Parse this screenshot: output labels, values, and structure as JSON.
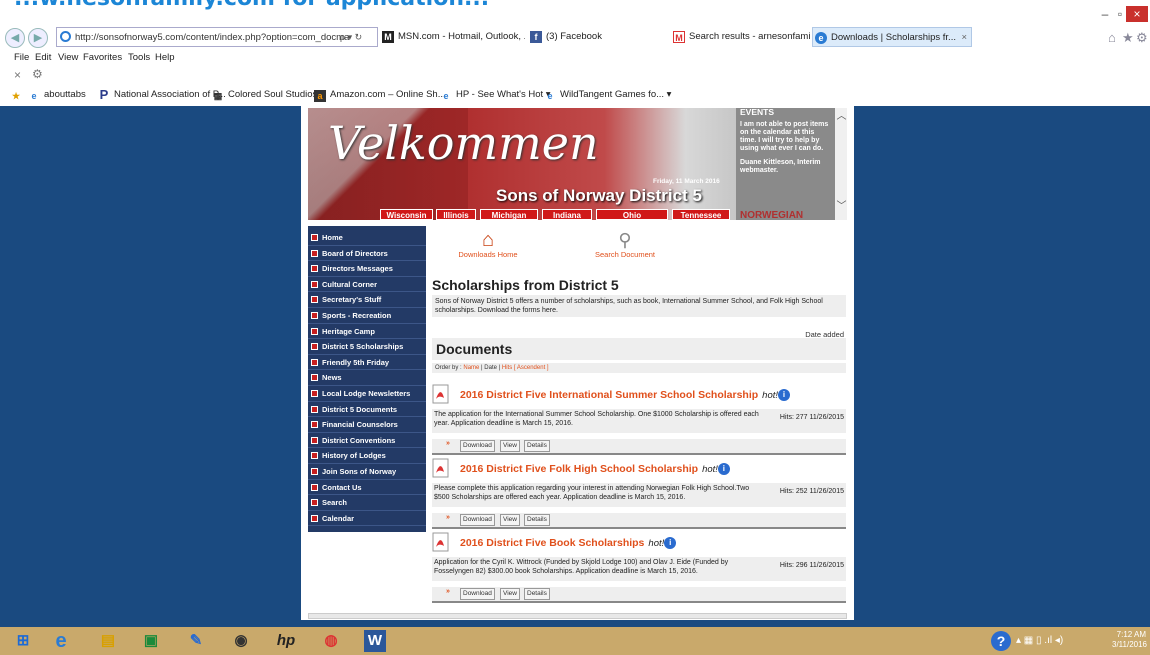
{
  "top_banner": {
    "text": "...w.nesonfamily.com for application..."
  },
  "browser": {
    "address": "http://sonsofnorway5.com/content/index.php?option=com_docma",
    "address_icons": "ρ ▾ ↻",
    "tabs": [
      {
        "label": "MSN.com - Hotmail, Outlook, ...",
        "icon": "msn-icon"
      },
      {
        "label": "(3) Facebook",
        "icon": "facebook-icon"
      },
      {
        "label": "Search results - arnesonfamily...",
        "icon": "gmail-icon"
      },
      {
        "label": "Downloads | Scholarships fr...",
        "icon": "ie-icon"
      }
    ],
    "tab_close": "×",
    "menu": [
      "File",
      "Edit",
      "View",
      "Favorites",
      "Tools",
      "Help"
    ],
    "command_close": "×",
    "favorites": [
      "abouttabs",
      "National Association of P...",
      "Colored Soul Studios",
      "Amazon.com – Online Sh...",
      "HP - See What's Hot ▾",
      "WildTangent Games fo... ▾"
    ],
    "window_controls": {
      "minimize": "–",
      "maximize": "▫",
      "close": "×"
    }
  },
  "site": {
    "welcome": "Velkommen",
    "date": "Friday, 11 March 2016",
    "title": "Sons of Norway District 5",
    "states": [
      "Wisconsin",
      "Illinois",
      "Michigan",
      "Indiana",
      "Ohio",
      "Tennessee"
    ],
    "events": {
      "heading": "EVENTS",
      "text1": "I am not able to post items on the calendar at this time.  I will try to help by using what ever I can do.",
      "text2": "Duane Kittleson, Interim webmaster.",
      "more": "NORWEGIAN"
    },
    "menu": [
      "Home",
      "Board of Directors",
      "Directors Messages",
      "Cultural Corner",
      "Secretary's Stuff",
      "Sports - Recreation",
      "Heritage Camp",
      "District 5 Scholarships",
      "Friendly 5th Friday",
      "News",
      "Local Lodge Newsletters",
      "District 5 Documents",
      "Financial Counselors",
      "District Conventions",
      "History of Lodges",
      "Join Sons of Norway",
      "Contact Us",
      "Search",
      "Calendar"
    ],
    "downloads_home": "Downloads Home",
    "search_document": "Search Document",
    "section_title": "Scholarships from District 5",
    "section_desc": "Sons of Norway District 5 offers a number of scholarships, such as book, International Summer School, and Folk High School scholarships. Download the forms here.",
    "date_added": "Date added",
    "documents_heading": "Documents",
    "order_by": {
      "label": "Order by :",
      "name": "Name",
      "sep1": "|",
      "date": "Date",
      "sep2": "|",
      "hits": "Hits [ Ascendent ]"
    },
    "documents": [
      {
        "title": "2016 District Five International Summer School Scholarship",
        "hot": "hot!",
        "desc": "The application for the International Summer School Scholarship. One $1000 Scholarship is offered each year. Application deadline is March 15, 2016.",
        "hits": "Hits: 277 11/26/2015"
      },
      {
        "title": "2016 District Five Folk High School Scholarship",
        "hot": "hot!",
        "desc": "Please complete this application regarding your interest in attending Norwegian Folk High School.Two $500 Scholarships are offered each year. Application deadline is March 15, 2016.",
        "hits": "Hits: 252 11/26/2015"
      },
      {
        "title": "2016 District Five Book Scholarships",
        "hot": "hot!",
        "desc": "Application for the Cyril K. Wittrock (Funded by Skjold Lodge 100) and Olav J. Eide (Funded by Fosselyngen 82) $300.00 book Scholarships. Application deadline is March 15, 2016.",
        "hits": "Hits: 296 11/26/2015"
      }
    ],
    "buttons": {
      "arrows": "»",
      "download": "Download",
      "view": "View",
      "details": "Details"
    }
  },
  "taskbar": {
    "clock_time": "7:12 AM",
    "clock_date": "3/11/2016",
    "help": "?",
    "tray": "▴  ▦  ▯  .ıl  ◂)"
  },
  "colors": {
    "accent_orange": "#e0501c",
    "menu_navy": "#233a66",
    "page_blue": "#1a4a80",
    "taskbar_tan": "#c9a96b"
  }
}
